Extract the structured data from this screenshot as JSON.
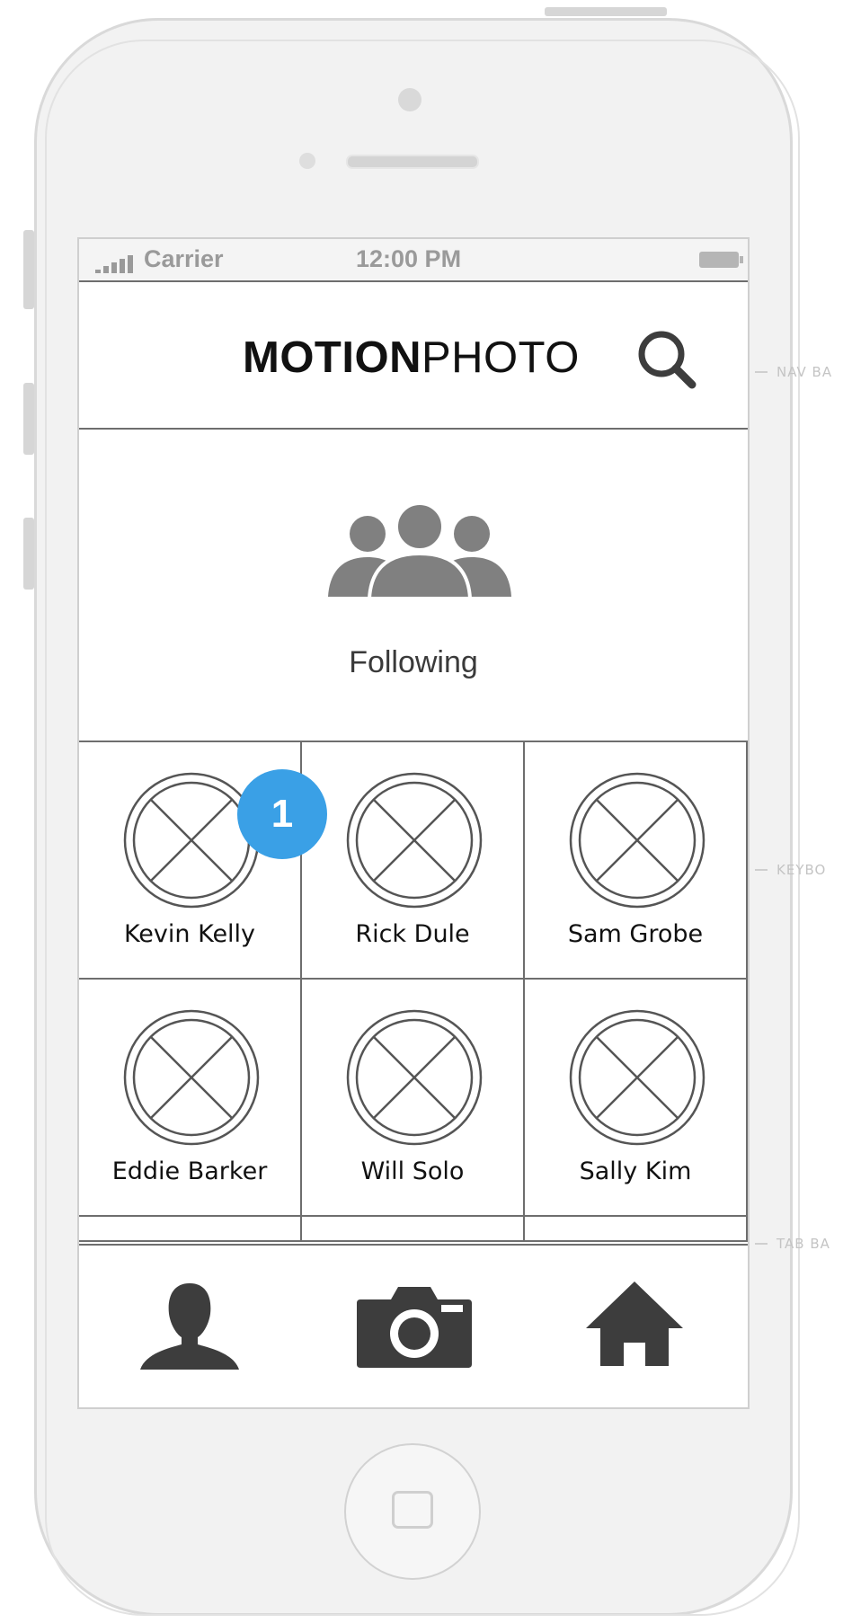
{
  "status_bar": {
    "carrier": "Carrier",
    "time": "12:00 PM"
  },
  "nav_bar": {
    "logo_bold": "MOTION",
    "logo_regular": "PHOTO",
    "search_icon": "search-icon"
  },
  "section": {
    "title": "Following",
    "icon": "people-group-icon"
  },
  "people": [
    {
      "name": "Kevin Kelly"
    },
    {
      "name": "Rick Dule"
    },
    {
      "name": "Sam Grobe"
    },
    {
      "name": "Eddie Barker"
    },
    {
      "name": "Will Solo"
    },
    {
      "name": "Sally Kim"
    }
  ],
  "annotation_badge": {
    "number": "1",
    "color": "#3aa0e6"
  },
  "tab_bar": {
    "tabs": [
      {
        "icon": "profile-icon"
      },
      {
        "icon": "camera-icon"
      },
      {
        "icon": "home-icon"
      }
    ]
  },
  "callouts": {
    "nav_bar": "NAV BA",
    "keyboard": "KEYBO",
    "tab_bar": "TAB BA"
  },
  "colors": {
    "accent": "#3aa0e6",
    "icon_gray": "#808080",
    "icon_dark": "#3d3d3d",
    "border": "#6e6e6e"
  }
}
